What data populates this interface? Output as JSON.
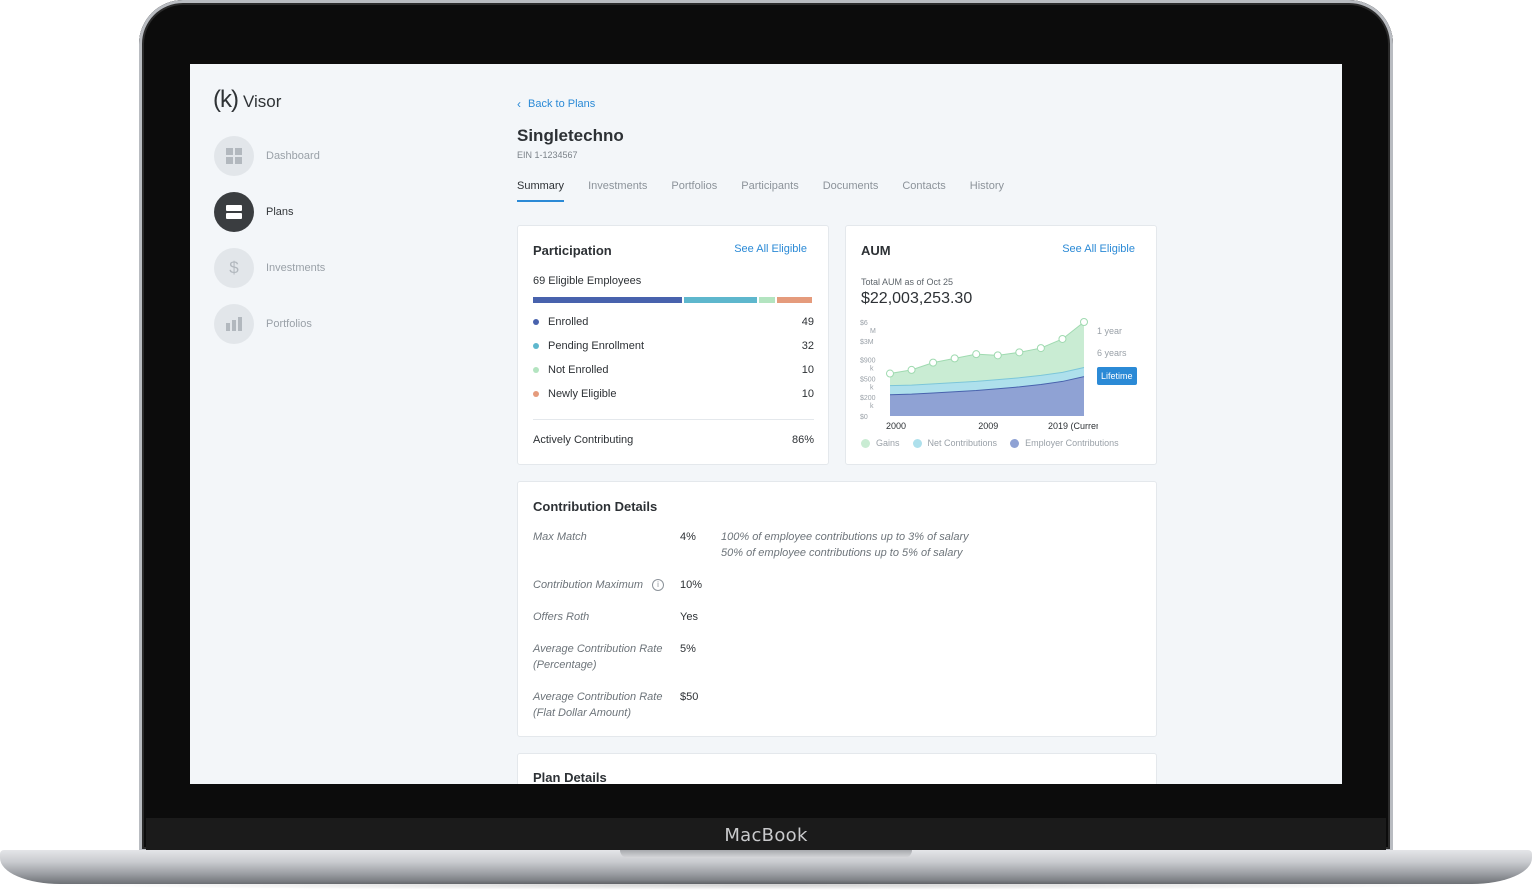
{
  "device": {
    "brand": "MacBook"
  },
  "app": {
    "logo_mark": "(k)",
    "logo_text": "Visor"
  },
  "sidebar": {
    "items": [
      {
        "label": "Dashboard",
        "icon": "grid-icon",
        "active": false
      },
      {
        "label": "Plans",
        "icon": "plans-icon",
        "active": true
      },
      {
        "label": "Investments",
        "icon": "dollar-icon",
        "active": false
      },
      {
        "label": "Portfolios",
        "icon": "bar-chart-icon",
        "active": false
      }
    ]
  },
  "header": {
    "back_label": "Back to Plans",
    "title": "Singletechno",
    "ein": "EIN 1-1234567"
  },
  "tabs": [
    {
      "label": "Summary",
      "active": true
    },
    {
      "label": "Investments",
      "active": false
    },
    {
      "label": "Portfolios",
      "active": false
    },
    {
      "label": "Participants",
      "active": false
    },
    {
      "label": "Documents",
      "active": false
    },
    {
      "label": "Contacts",
      "active": false
    },
    {
      "label": "History",
      "active": false
    }
  ],
  "participation": {
    "title": "Participation",
    "link": "See All Eligible",
    "subtitle": "69 Eligible Employees",
    "rows": [
      {
        "label": "Enrolled",
        "value": "49",
        "color": "#4862ad"
      },
      {
        "label": "Pending Enrollment",
        "value": "32",
        "color": "#5eb7cd"
      },
      {
        "label": "Not Enrolled",
        "value": "10",
        "color": "#b3e4c0"
      },
      {
        "label": "Newly Eligible",
        "value": "10",
        "color": "#e59b7c"
      }
    ],
    "active_label": "Actively Contributing",
    "active_value": "86%"
  },
  "aum": {
    "title": "AUM",
    "link": "See All Eligible",
    "caption": "Total AUM as of Oct 25",
    "value": "$22,003,253.30",
    "ranges": [
      {
        "label": "1 year",
        "active": false
      },
      {
        "label": "6 years",
        "active": false
      },
      {
        "label": "Lifetime",
        "active": true
      }
    ],
    "legend": [
      {
        "label": "Gains",
        "color": "#c9ecd3"
      },
      {
        "label": "Net Contributions",
        "color": "#aee0ec"
      },
      {
        "label": "Employer Contributions",
        "color": "#8fa2d4"
      }
    ]
  },
  "chart_data": {
    "type": "area",
    "x": [
      "2000",
      "2002",
      "2004",
      "2006",
      "2008",
      "2010",
      "2012",
      "2014",
      "2016",
      "2019"
    ],
    "x_tick_labels": [
      "2000",
      "2009",
      "2019 (Current)"
    ],
    "y_tick_labels": [
      "$6 M",
      "$3M",
      "$900 k",
      "$500 k",
      "$200 k",
      "$0"
    ],
    "series": [
      {
        "name": "Employer Contributions",
        "values": [
          0.35,
          0.36,
          0.38,
          0.4,
          0.42,
          0.45,
          0.48,
          0.52,
          0.57,
          0.65
        ]
      },
      {
        "name": "Net Contributions",
        "values": [
          0.15,
          0.15,
          0.15,
          0.15,
          0.15,
          0.15,
          0.15,
          0.15,
          0.15,
          0.15
        ]
      },
      {
        "name": "Gains",
        "values": [
          0.2,
          0.25,
          0.35,
          0.4,
          0.45,
          0.4,
          0.42,
          0.45,
          0.55,
          0.75
        ]
      }
    ],
    "ylim": [
      0,
      1.55
    ],
    "legend_position": "bottom"
  },
  "contribution": {
    "title": "Contribution Details",
    "rows": [
      {
        "label": "Max Match",
        "value": "4%",
        "desc": [
          "100% of employee contributions up to 3% of salary",
          "50% of employee contributions up to 5% of salary"
        ]
      },
      {
        "label": "Contribution Maximum",
        "value": "10%",
        "info": true
      },
      {
        "label": "Offers Roth",
        "value": "Yes"
      },
      {
        "label": "Average Contribution Rate (Percentage)",
        "value": "5%"
      },
      {
        "label": "Average Contribution Rate (Flat Dollar Amount)",
        "value": "$50"
      }
    ]
  },
  "plan_details": {
    "title": "Plan Details"
  }
}
